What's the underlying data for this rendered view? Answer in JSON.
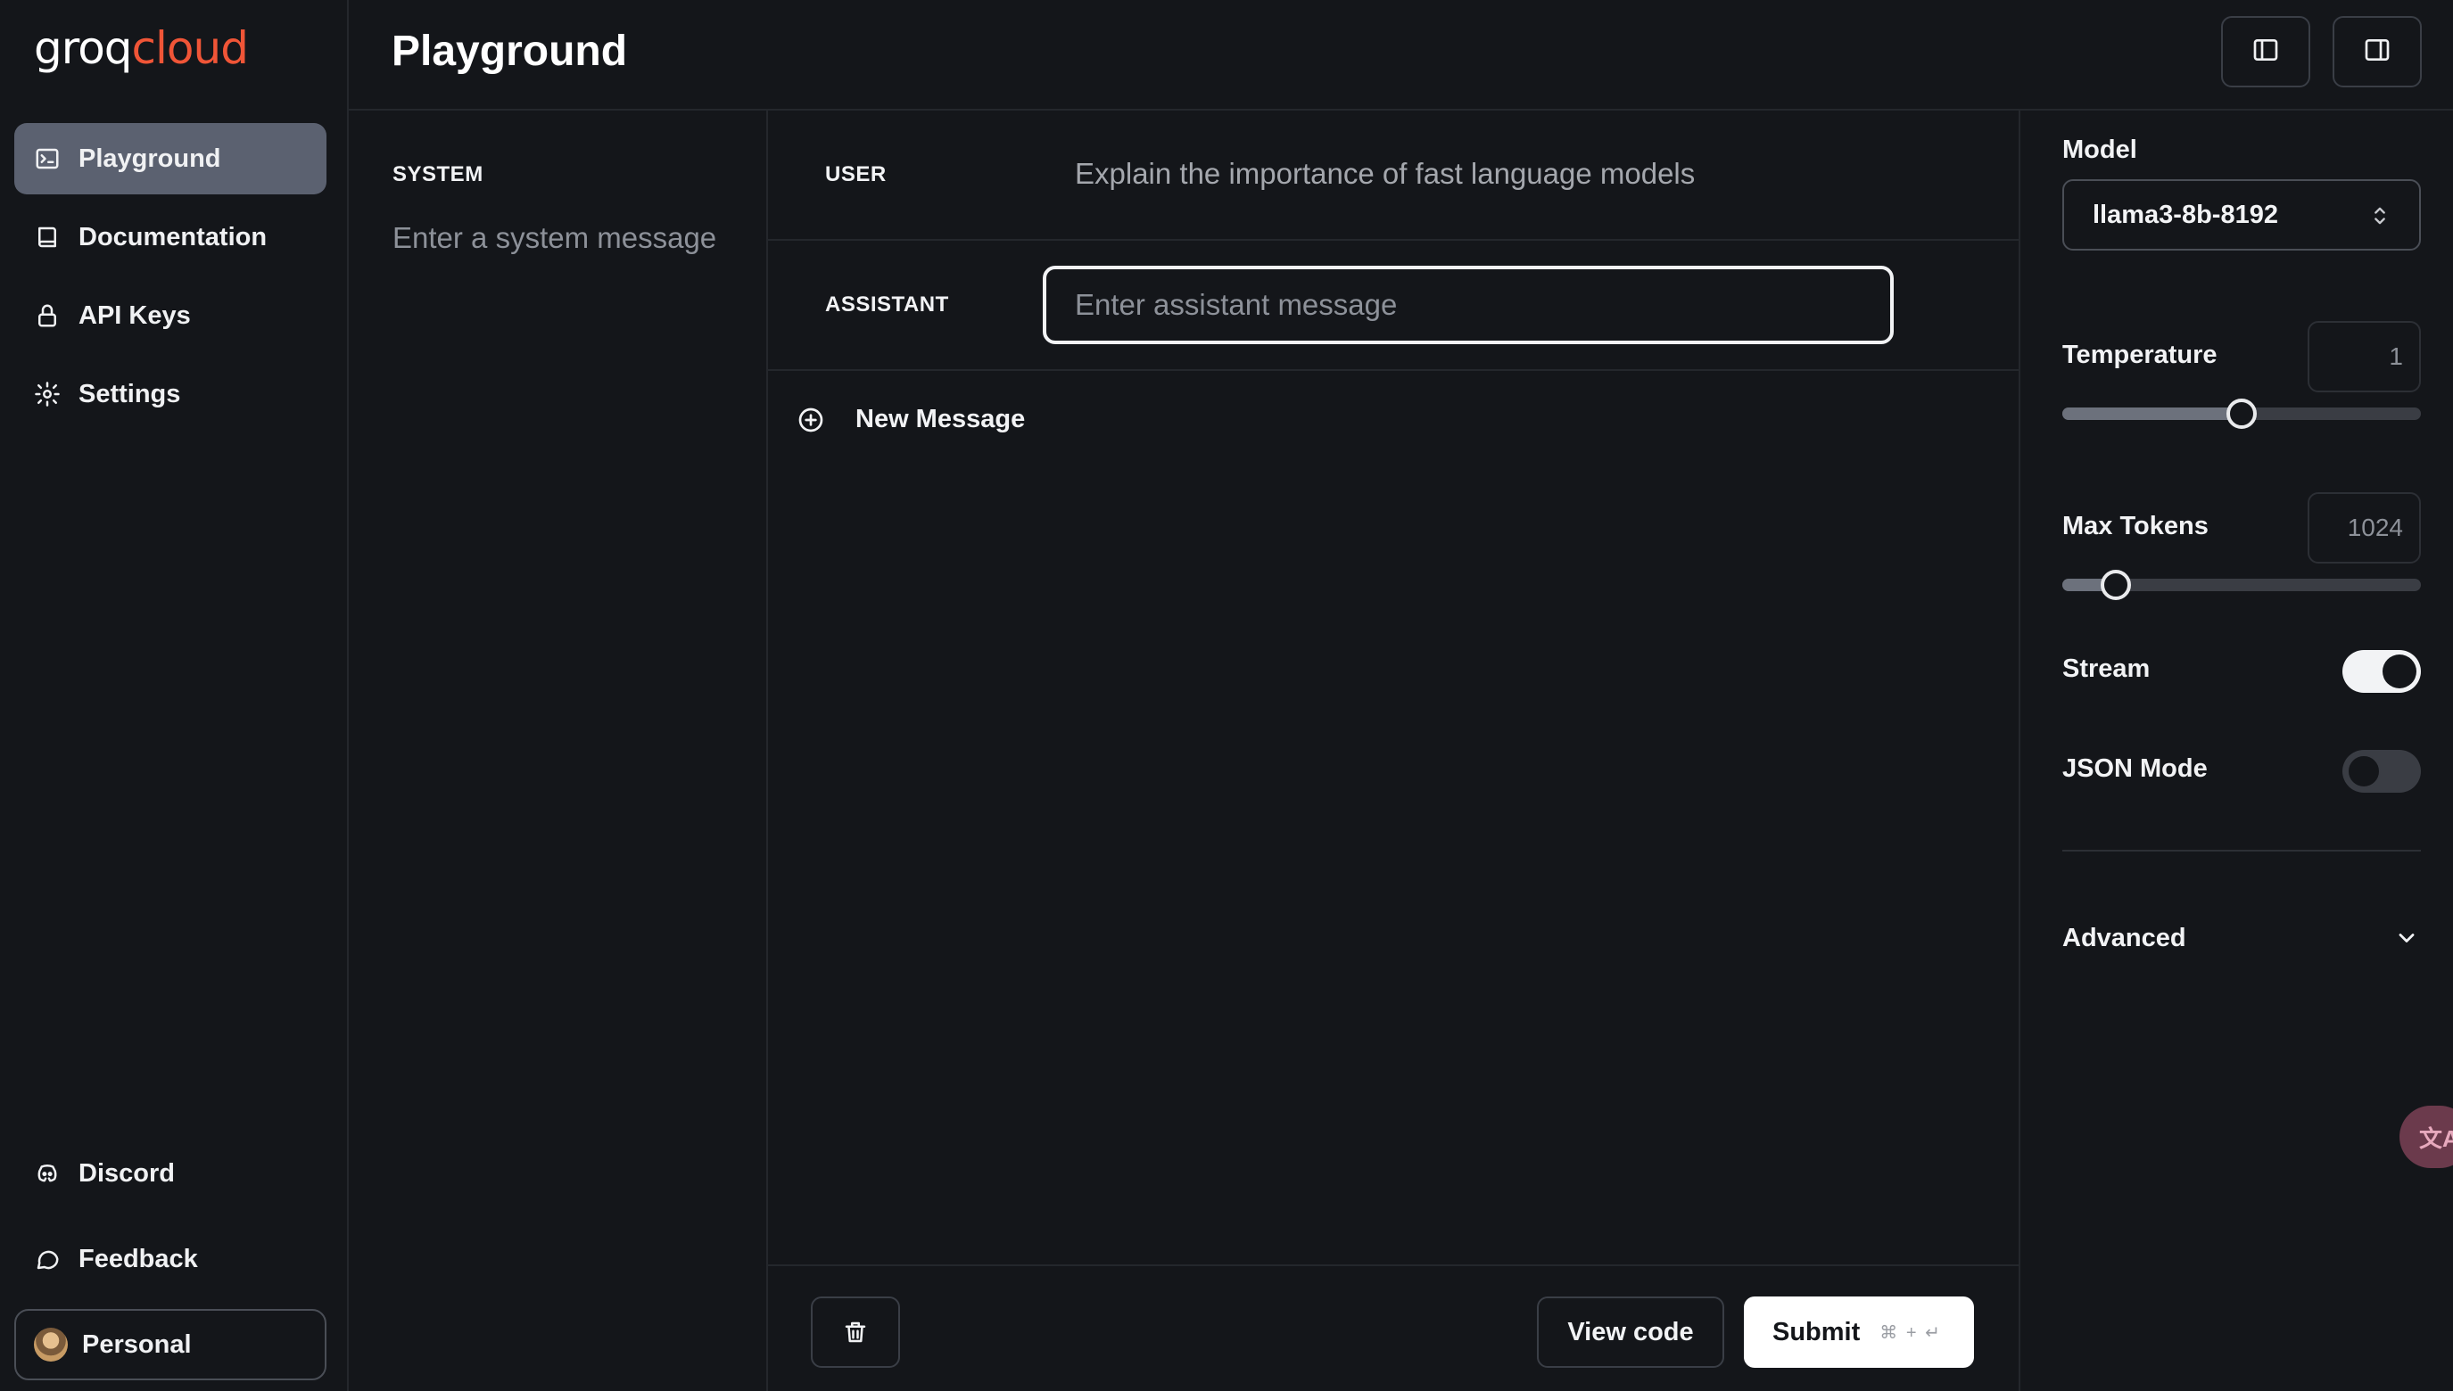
{
  "brand": {
    "part1": "groq",
    "part2": "cloud"
  },
  "sidebar": {
    "items": [
      {
        "label": "Playground",
        "icon": "terminal-icon",
        "active": true
      },
      {
        "label": "Documentation",
        "icon": "book-icon"
      },
      {
        "label": "API Keys",
        "icon": "lock-icon"
      },
      {
        "label": "Settings",
        "icon": "gear-icon"
      }
    ],
    "bottom": [
      {
        "label": "Discord",
        "icon": "discord-icon"
      },
      {
        "label": "Feedback",
        "icon": "chat-bubble-icon"
      }
    ],
    "account": {
      "label": "Personal",
      "icon": "avatar"
    }
  },
  "header": {
    "title": "Playground",
    "left_panel_toggle": "panel-left-icon",
    "right_panel_toggle": "panel-right-icon"
  },
  "system": {
    "label": "SYSTEM",
    "placeholder": "Enter a system message"
  },
  "messages": [
    {
      "role": "USER",
      "text": "Explain the importance of fast language models"
    },
    {
      "role": "ASSISTANT",
      "placeholder": "Enter assistant message"
    }
  ],
  "new_message_label": "New Message",
  "footer": {
    "delete_icon": "trash-icon",
    "view_code_label": "View code",
    "submit_label": "Submit",
    "submit_shortcut": "⌘ + ↵"
  },
  "settings": {
    "model_label": "Model",
    "model_value": "llama3-8b-8192",
    "temperature_label": "Temperature",
    "temperature_value": "1",
    "temperature_fraction": 0.5,
    "max_tokens_label": "Max Tokens",
    "max_tokens_value": "1024",
    "max_tokens_fraction": 0.15,
    "stream_label": "Stream",
    "stream_on": true,
    "json_mode_label": "JSON Mode",
    "json_mode_on": false,
    "advanced_label": "Advanced"
  },
  "colors": {
    "background": "#14161a",
    "active_nav": "#5b6170",
    "brand_accent": "#f05537",
    "border": "#24272c"
  }
}
